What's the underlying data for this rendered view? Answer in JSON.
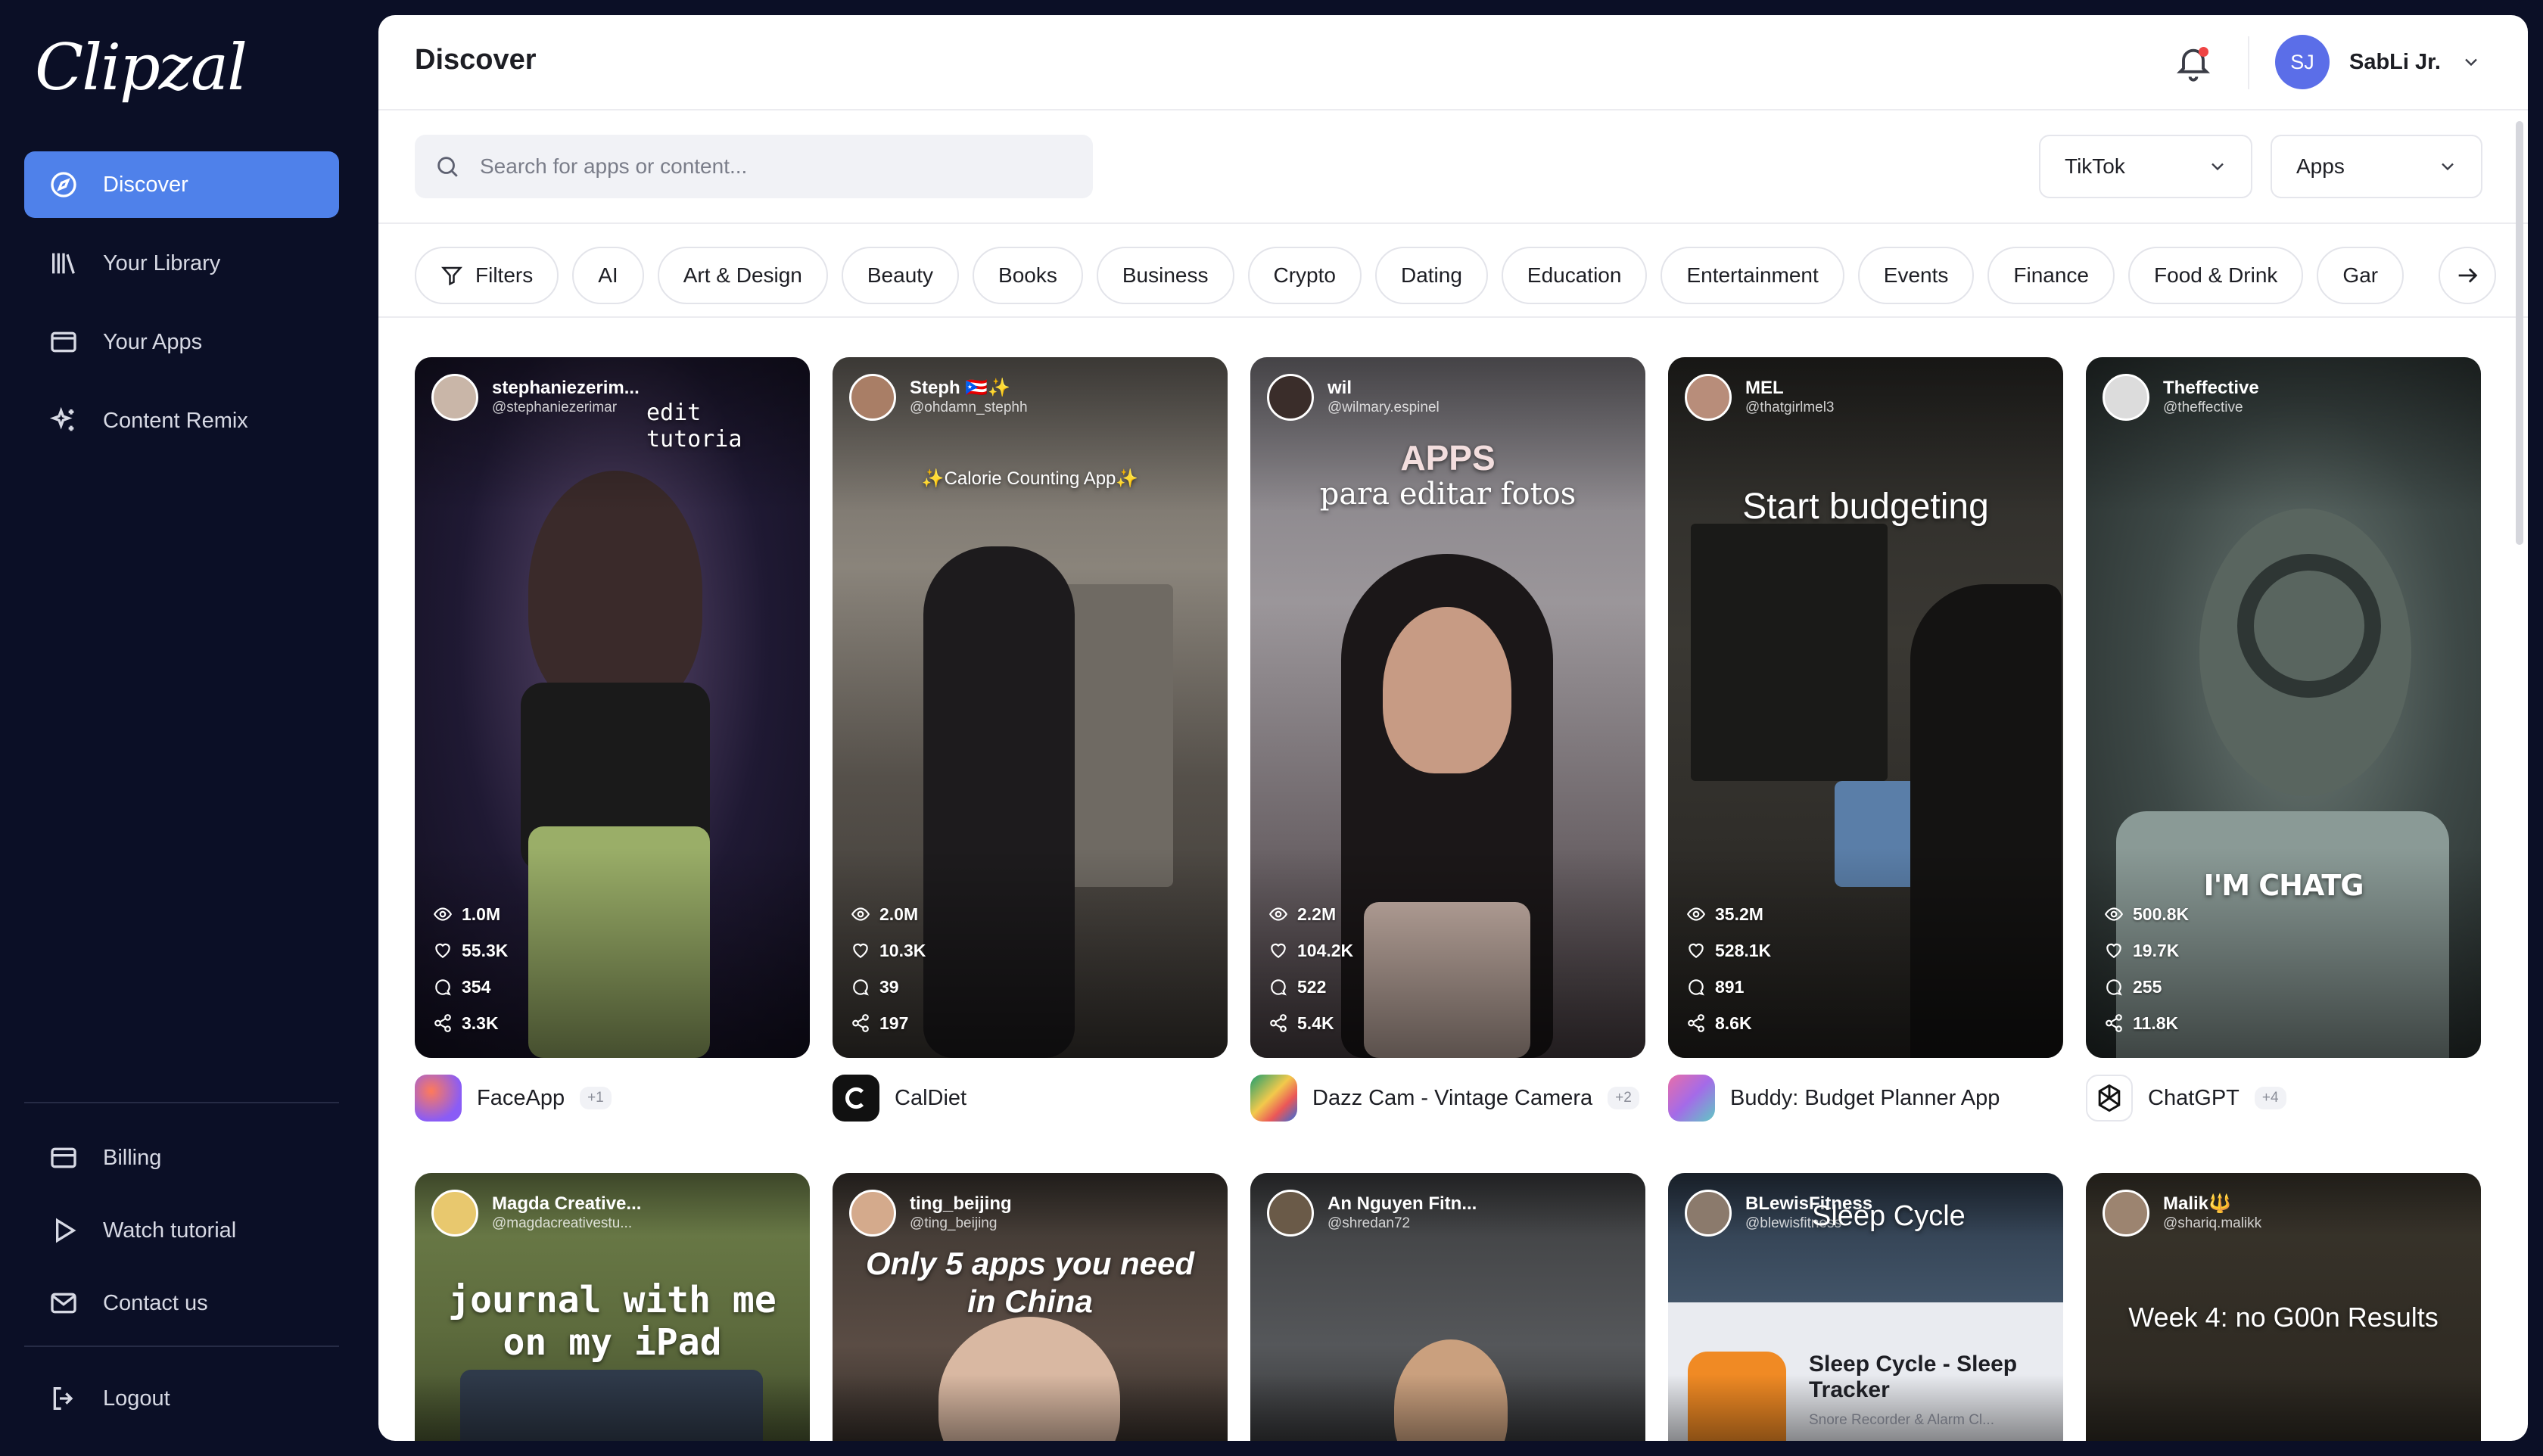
{
  "brand": {
    "logo": "Clipzal"
  },
  "sidebar": {
    "items": [
      {
        "label": "Discover",
        "icon": "compass-icon",
        "active": true
      },
      {
        "label": "Your Library",
        "icon": "library-icon"
      },
      {
        "label": "Your Apps",
        "icon": "window-icon"
      },
      {
        "label": "Content Remix",
        "icon": "sparkles-icon"
      }
    ],
    "bottom": [
      {
        "label": "Billing",
        "icon": "credit-card-icon"
      },
      {
        "label": "Watch tutorial",
        "icon": "play-icon"
      },
      {
        "label": "Contact us",
        "icon": "mail-icon"
      }
    ],
    "logout": {
      "label": "Logout",
      "icon": "logout-icon"
    }
  },
  "header": {
    "title": "Discover",
    "user": {
      "initials": "SJ",
      "name": "SabLi Jr."
    }
  },
  "search": {
    "placeholder": "Search for apps or content..."
  },
  "selects": {
    "platform": "TikTok",
    "type": "Apps"
  },
  "filters": {
    "button": "Filters",
    "categories": [
      "AI",
      "Art & Design",
      "Beauty",
      "Books",
      "Business",
      "Crypto",
      "Dating",
      "Education",
      "Entertainment",
      "Events",
      "Finance",
      "Food & Drink",
      "Gar"
    ]
  },
  "videos": [
    {
      "name": "stephaniezerim...",
      "handle": "@stephaniezerimar",
      "overlay": "edit tutoria",
      "views": "1.0M",
      "likes": "55.3K",
      "comments": "354",
      "shares": "3.3K",
      "app": "FaceApp",
      "more": "+1"
    },
    {
      "name": "Steph 🇵🇷✨",
      "handle": "@ohdamn_stephh",
      "overlay": "✨Calorie Counting App✨",
      "views": "2.0M",
      "likes": "10.3K",
      "comments": "39",
      "shares": "197",
      "app": "CalDiet",
      "more": ""
    },
    {
      "name": "wil",
      "handle": "@wilmary.espinel",
      "overlay": "APPS",
      "overlay2": "para editar fotos",
      "views": "2.2M",
      "likes": "104.2K",
      "comments": "522",
      "shares": "5.4K",
      "app": "Dazz Cam - Vintage Camera",
      "more": "+2"
    },
    {
      "name": "MEL",
      "handle": "@thatgirlmel3",
      "overlay": "Start budgeting",
      "views": "35.2M",
      "likes": "528.1K",
      "comments": "891",
      "shares": "8.6K",
      "app": "Buddy: Budget Planner App",
      "more": ""
    },
    {
      "name": "Theffective",
      "handle": "@theffective",
      "overlay": "I'M CHATG",
      "views": "500.8K",
      "likes": "19.7K",
      "comments": "255",
      "shares": "11.8K",
      "app": "ChatGPT",
      "more": "+4"
    }
  ],
  "videos_row2": [
    {
      "name": "Magda Creative...",
      "handle": "@magdacreativestu...",
      "overlay": "journal with me",
      "overlay2": "on my iPad"
    },
    {
      "name": "ting_beijing",
      "handle": "@ting_beijing",
      "overlay": "Only 5 apps you need",
      "overlay2": "in China"
    },
    {
      "name": "An Nguyen Fitn...",
      "handle": "@shredan72",
      "overlay": ""
    },
    {
      "name": "BLewisFitness",
      "handle": "@blewisfitness",
      "overlay": "Sleep Cycle",
      "overlay2": "Sleep Cycle - Sleep Tracker",
      "overlay3": "Snore Recorder & Alarm Cl..."
    },
    {
      "name": "Malik🔱",
      "handle": "@shariq.malikk",
      "overlay": "Week 4: no G00n Results"
    }
  ]
}
